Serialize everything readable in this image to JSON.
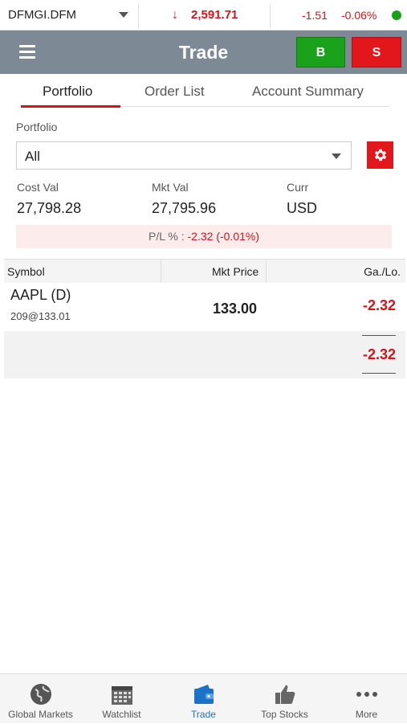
{
  "ticker": {
    "symbol": "DFMGI.DFM",
    "index_value": "2,591.71",
    "change": "-1.51",
    "change_pct": "-0.06%"
  },
  "header": {
    "title": "Trade",
    "buy_label": "B",
    "sell_label": "S"
  },
  "tabs": [
    {
      "label": "Portfolio"
    },
    {
      "label": "Order List"
    },
    {
      "label": "Account Summary"
    }
  ],
  "portfolio": {
    "label": "Portfolio",
    "selected": "All"
  },
  "stats": {
    "cost_val_label": "Cost Val",
    "cost_val": "27,798.28",
    "mkt_val_label": "Mkt Val",
    "mkt_val": "27,795.96",
    "curr_label": "Curr",
    "curr": "USD"
  },
  "pl": {
    "label": "P/L % :",
    "value": "-2.32 (-0.01%)"
  },
  "table": {
    "headers": [
      "Symbol",
      "Mkt Price",
      "Ga./Lo."
    ],
    "rows": [
      {
        "symbol": "AAPL (D)",
        "qty": "209@133.01",
        "price": "133.00",
        "gain": "-2.32"
      }
    ],
    "total": "-2.32"
  },
  "nav": [
    {
      "label": "Global Markets"
    },
    {
      "label": "Watchlist"
    },
    {
      "label": "Trade"
    },
    {
      "label": "Top Stocks"
    },
    {
      "label": "More"
    }
  ],
  "colors": {
    "accent_red": "#d4141a",
    "buy_green": "#1aa31a",
    "header_grey": "#7d8a96",
    "active_blue": "#1a73c6"
  }
}
